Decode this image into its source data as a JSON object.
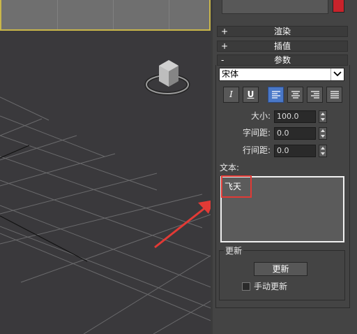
{
  "rollouts": {
    "render": {
      "symbol": "+",
      "label": "渲染"
    },
    "interp": {
      "symbol": "+",
      "label": "插值"
    },
    "params": {
      "symbol": "-",
      "label": "参数"
    }
  },
  "font_select": {
    "value": "宋体"
  },
  "format_buttons": {
    "italic": "I",
    "underline": "U"
  },
  "fields": {
    "size": {
      "label": "大小:",
      "value": "100.0"
    },
    "kerning": {
      "label": "字间距:",
      "value": "0.0"
    },
    "leading": {
      "label": "行间距:",
      "value": "0.0"
    }
  },
  "text_section": {
    "label": "文本:",
    "value": "飞天"
  },
  "update": {
    "group_label": "更新",
    "button_label": "更新",
    "manual_label": "手动更新"
  },
  "colors": {
    "accent": "#4a78c8",
    "swatch": "#c8232b",
    "highlight": "#e23a35"
  },
  "icons": [
    "view-cube-icon",
    "align-left-icon",
    "align-center-icon",
    "align-right-icon",
    "justify-icon",
    "chevron-down-icon"
  ]
}
